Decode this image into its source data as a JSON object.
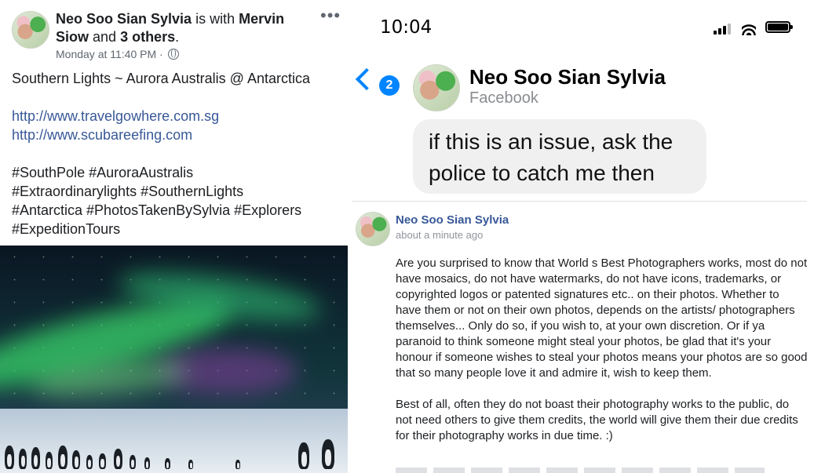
{
  "post": {
    "author": "Neo Soo Sian Sylvia",
    "with_text": " is with ",
    "tagged": "Mervin Siow",
    "and_text": " and ",
    "others": "3 others",
    "period": ".",
    "timestamp": "Monday at 11:40 PM ·",
    "more": "•••",
    "caption": "Southern Lights ~ Aurora Australis @ Antarctica",
    "links": [
      "http://www.travelgowhere.com.sg",
      "http://www.scubareefing.com"
    ],
    "hashtags": [
      "#SouthPole #AuroraAustralis",
      "#Extraordinarylights #SouthernLights",
      "#Antarctica #PhotosTakenBySylvia #Explorers",
      "#ExpeditionTours"
    ]
  },
  "status_bar": {
    "time": "10:04"
  },
  "messenger": {
    "unread_badge": "2",
    "contact_name": "Neo Soo Sian Sylvia",
    "contact_sub": "Facebook",
    "message": "if this is an issue, ask the police to catch me then"
  },
  "comment": {
    "author": "Neo Soo Sian Sylvia",
    "time": "about a minute ago",
    "paragraphs": [
      "Are you surprised to know that World s Best Photographers works, most do not have mosaics, do not have watermarks, do not have icons, trademarks, or copyrighted logos or patented signatures etc.. on their photos. Whether to have them or not on their own photos, depends on the artists/ photographers themselves... Only do so, if you wish to, at your own discretion. Or if ya paranoid to think someone might steal your photos, be glad that it's your honour if someone wishes to steal your photos means your photos are so good that so many people love it and admire it, wish to keep them.",
      "Best of all, often they do not boast their photography works to the public, do not need others to give them credits, the world will give them their due credits for their photography works in due time. :)"
    ]
  },
  "colors": {
    "fb_link": "#385898",
    "messenger_blue": "#0084ff",
    "bubble_gray": "#f0f0f0"
  }
}
